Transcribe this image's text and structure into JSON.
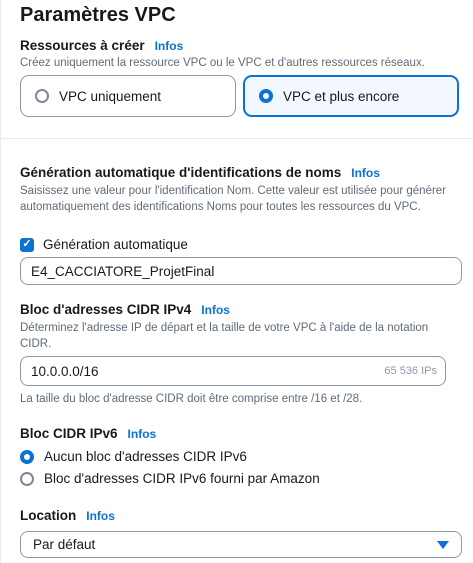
{
  "page_title": "Paramètres VPC",
  "info_label": "Infos",
  "resources": {
    "label": "Ressources à créer",
    "description": "Créez uniquement la ressource VPC ou le VPC et d'autres ressources réseaux.",
    "options": [
      "VPC uniquement",
      "VPC et plus encore"
    ],
    "selected": "VPC et plus encore"
  },
  "name_tag": {
    "label": "Génération automatique d'identifications de noms",
    "description": "Saisissez une valeur pour l'identification Nom. Cette valeur est utilisée pour générer automatiquement des identifications Noms pour toutes les ressources du VPC.",
    "checkbox_label": "Génération automatique",
    "checked": true,
    "value": "E4_CACCIATORE_ProjetFinal"
  },
  "ipv4": {
    "label": "Bloc d'adresses CIDR IPv4",
    "description": "Déterminez l'adresse IP de départ et la taille de votre VPC à l'aide de la notation CIDR.",
    "value": "10.0.0.0/16",
    "suffix": "65 536 IPs",
    "hint": "La taille du bloc d'adresse CIDR doit être comprise entre /16 et /28."
  },
  "ipv6": {
    "label": "Bloc CIDR IPv6",
    "options": [
      "Aucun bloc d'adresses CIDR IPv6",
      "Bloc d'adresses CIDR IPv6 fourni par Amazon"
    ],
    "selected": "Aucun bloc d'adresses CIDR IPv6"
  },
  "location": {
    "label": "Location",
    "value": "Par défaut"
  }
}
